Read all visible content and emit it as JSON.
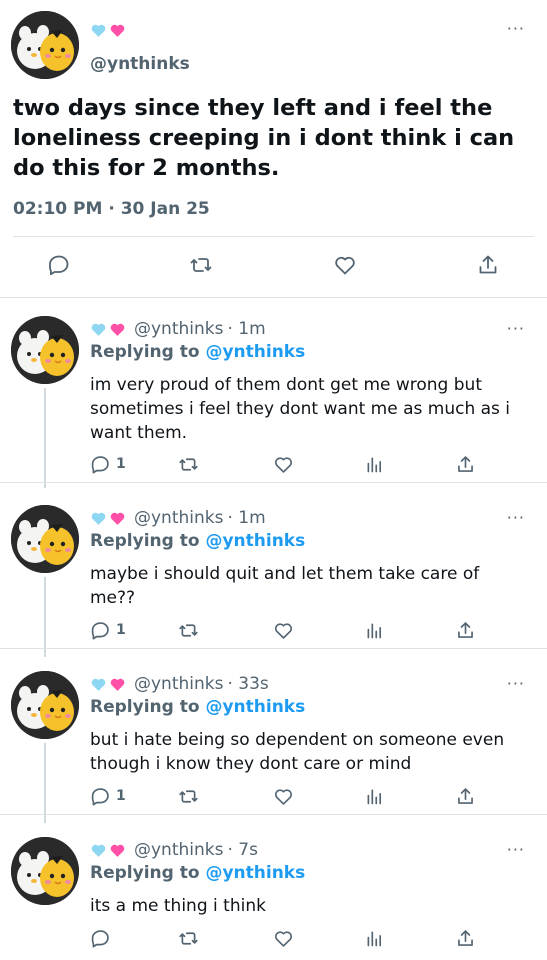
{
  "colors": {
    "accent": "#1d9bf0",
    "secondary_text": "#536471",
    "heart_blue": "#8ed7f2",
    "heart_pink": "#ff4fa6"
  },
  "main_tweet": {
    "hearts": [
      "light-blue-heart",
      "pink-heart"
    ],
    "handle": "@ynthinks",
    "text": "two days since they left and i feel the loneliness creeping in i dont think i can do this for 2 months.",
    "timestamp": "02:10 PM · 30 Jan 25",
    "more": "···"
  },
  "actions": [
    "reply-icon",
    "retweet-icon",
    "like-icon",
    "share-icon"
  ],
  "replies": [
    {
      "handle": "@ynthinks",
      "age": "· 1m",
      "replying_label": "Replying to",
      "replying_to": "@ynthinks",
      "text": "im very proud of them dont get me wrong but sometimes i feel they dont want me as much as i want them.",
      "reply_count": "1",
      "more": "···"
    },
    {
      "handle": "@ynthinks",
      "age": "· 1m",
      "replying_label": "Replying to",
      "replying_to": "@ynthinks",
      "text": "maybe i should quit and let them take care of me??",
      "reply_count": "1",
      "more": "···"
    },
    {
      "handle": "@ynthinks",
      "age": "· 33s",
      "replying_label": "Replying to",
      "replying_to": "@ynthinks",
      "text": "but i hate being so dependent on someone even though i know they dont care or mind",
      "reply_count": "1",
      "more": "···"
    },
    {
      "handle": "@ynthinks",
      "age": "· 7s",
      "replying_label": "Replying to",
      "replying_to": "@ynthinks",
      "text": "its a me thing i think",
      "reply_count": "",
      "more": "···"
    }
  ]
}
